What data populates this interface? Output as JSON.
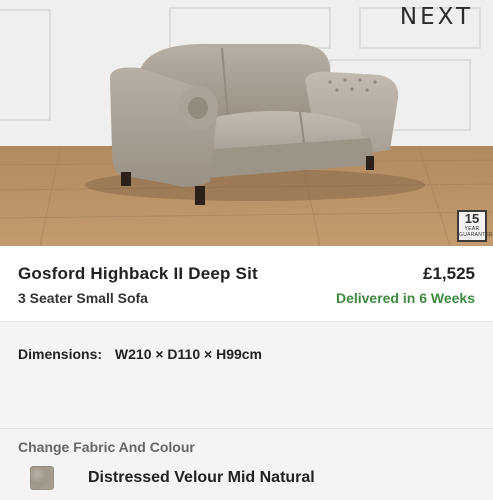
{
  "brand": {
    "name": "NEXT"
  },
  "hero": {
    "image": "grey chenille highback sofa on wooden floor",
    "guarantee": {
      "years": "15",
      "caption_line1": "YEAR",
      "caption_line2": "GUARANTEE"
    }
  },
  "product": {
    "name": "Gosford Highback II Deep Sit",
    "variant": "3 Seater Small Sofa",
    "price": "£1,525",
    "delivery": "Delivered in 6 Weeks"
  },
  "dimensions": {
    "label": "Dimensions:",
    "value": "W210 × D110 × H99cm"
  },
  "fabric": {
    "title": "Change Fabric And Colour",
    "selected": "Distressed Velour Mid Natural",
    "swatch_color": "#a59d91"
  },
  "colors": {
    "accent_green": "#3e8a3e",
    "background": "#f4f4f4"
  }
}
